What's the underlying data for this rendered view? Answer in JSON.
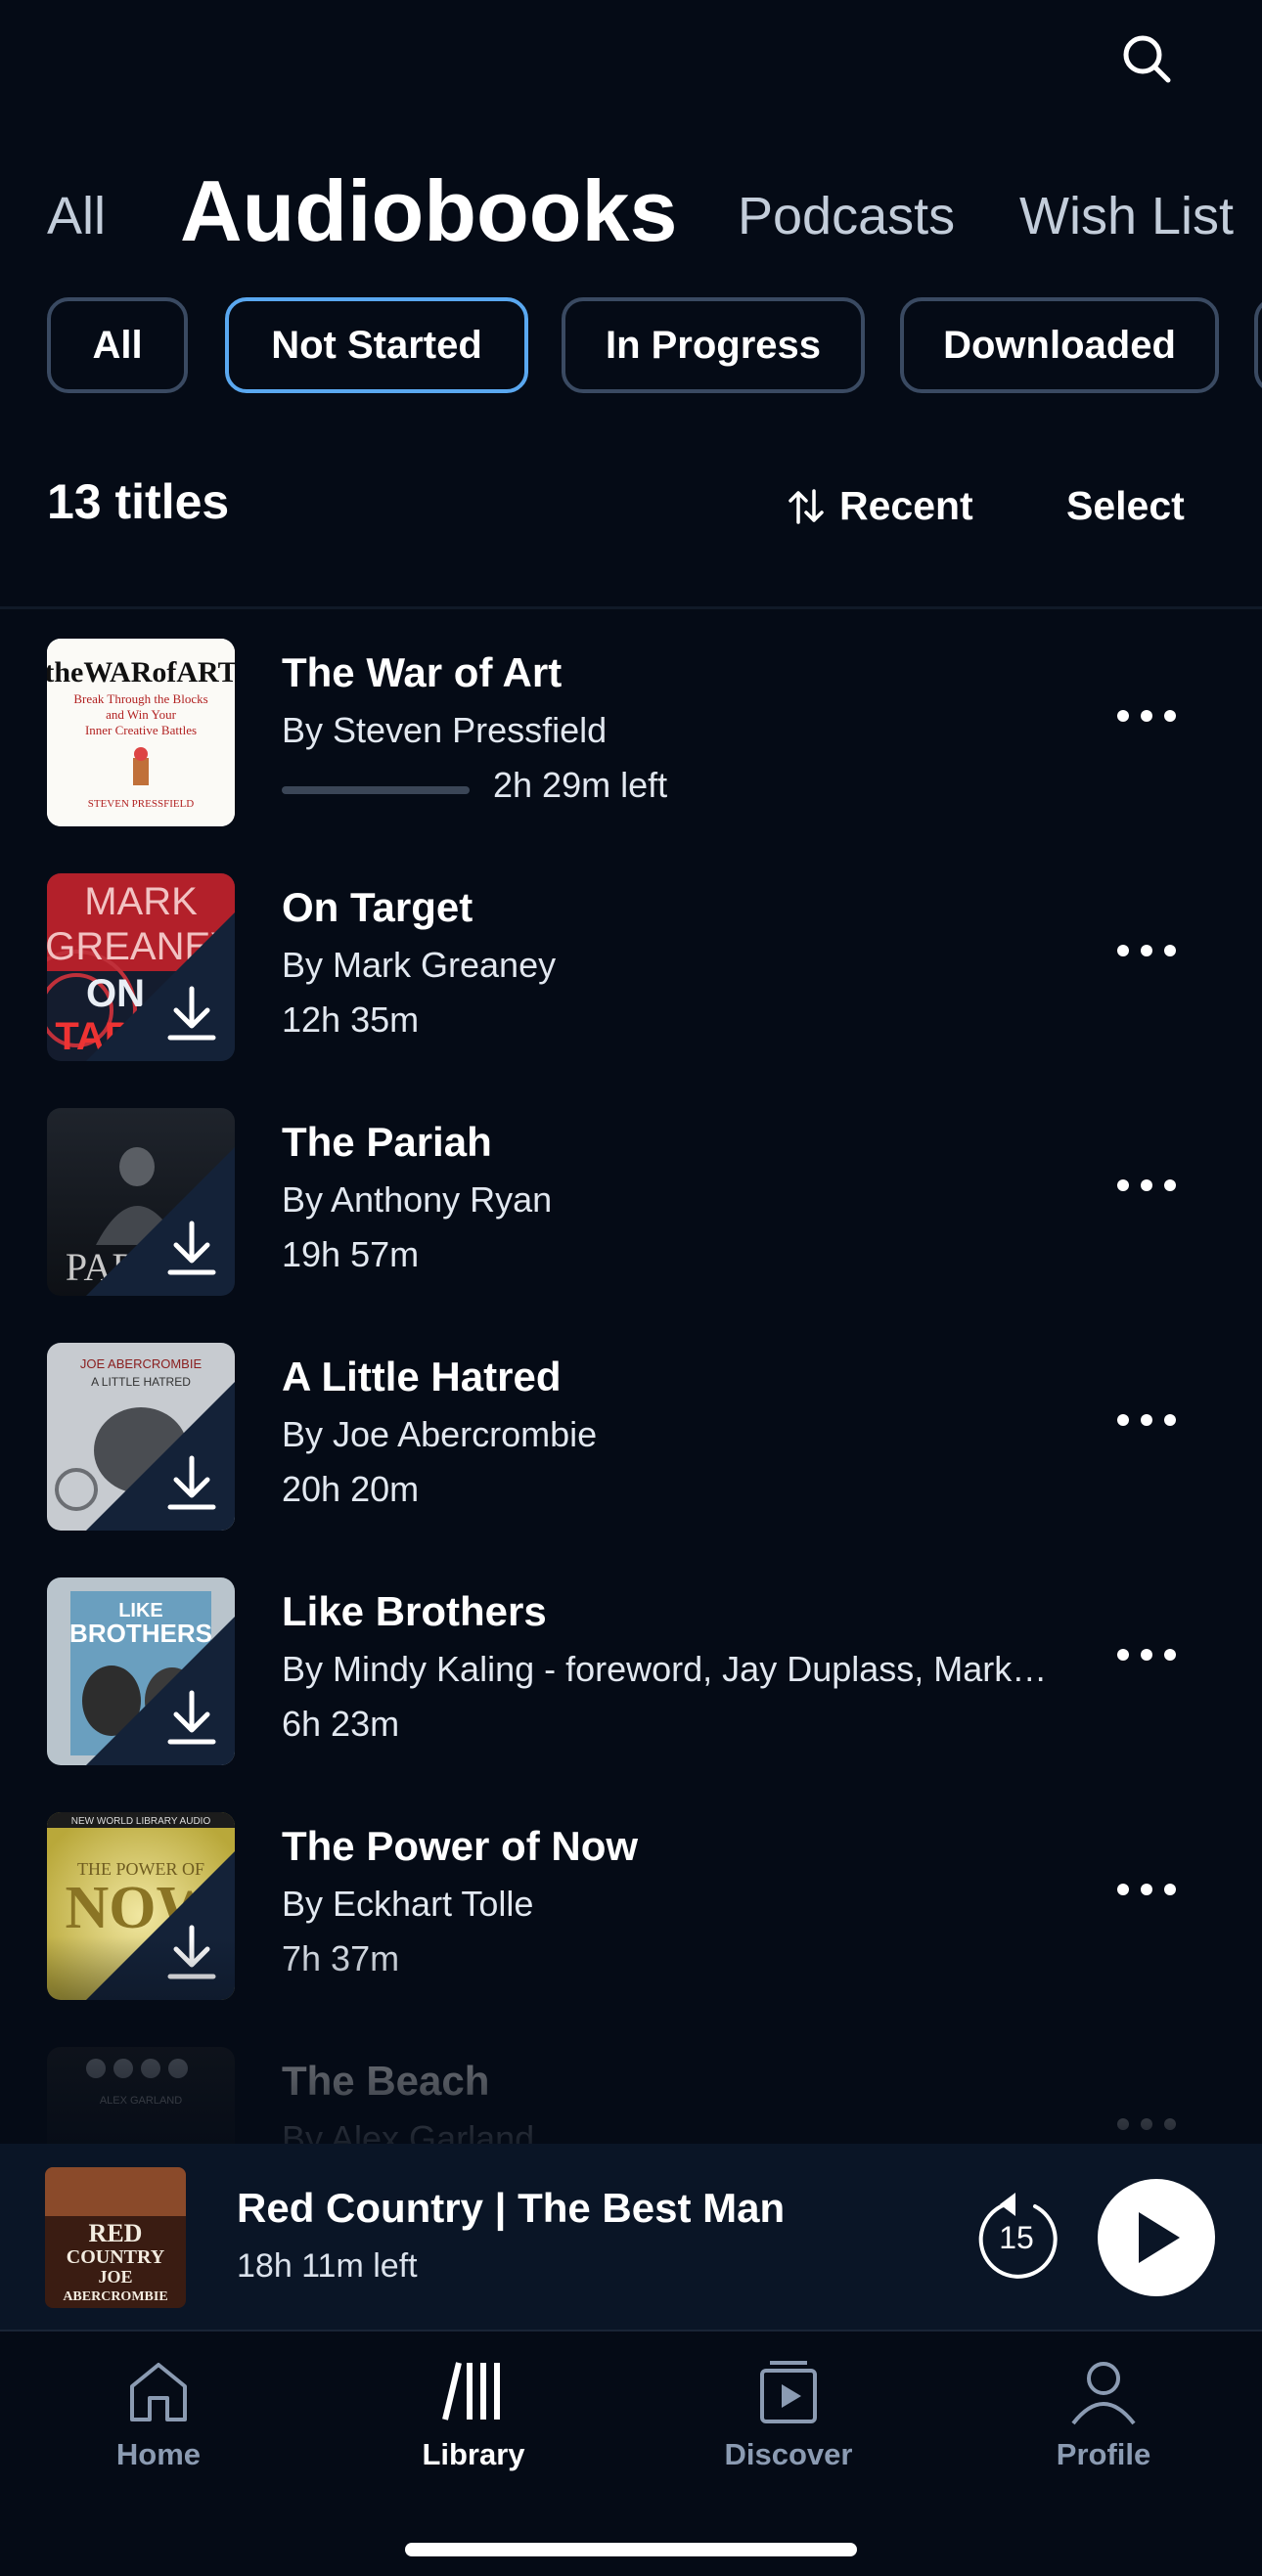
{
  "header": {
    "search_icon": "search-icon",
    "tabs": [
      {
        "label": "All",
        "active": false
      },
      {
        "label": "Audiobooks",
        "active": true
      },
      {
        "label": "Podcasts",
        "active": false
      },
      {
        "label": "Wish List",
        "active": false
      }
    ]
  },
  "filters": [
    {
      "label": "All",
      "active": false
    },
    {
      "label": "Not Started",
      "active": true
    },
    {
      "label": "In Progress",
      "active": false
    },
    {
      "label": "Downloaded",
      "active": false
    }
  ],
  "toolbar": {
    "count": "13 titles",
    "sort_label": "Recent",
    "select_label": "Select"
  },
  "books": [
    {
      "title": "The War of Art",
      "author": "By Steven Pressfield",
      "meta": "2h 29m left",
      "progress": 0.0,
      "downloaded": false,
      "cover_text": [
        "theWARofART",
        "Break Through the Blocks",
        "and Win Your",
        "Inner Creative Battles",
        "STEVEN PRESSFIELD"
      ]
    },
    {
      "title": "On Target",
      "author": "By Mark Greaney",
      "meta": "12h 35m",
      "downloaded": true,
      "cover_text": [
        "MARK",
        "GREANEY",
        "ON",
        "TAR"
      ]
    },
    {
      "title": "The Pariah",
      "author": "By Anthony Ryan",
      "meta": "19h 57m",
      "downloaded": true,
      "cover_text": [
        "PAR"
      ]
    },
    {
      "title": "A Little Hatred",
      "author": "By Joe Abercrombie",
      "meta": "20h 20m",
      "downloaded": true,
      "cover_text": [
        "JOE ABERCROMBIE",
        "A LITTLE HATRED"
      ]
    },
    {
      "title": "Like Brothers",
      "author": "By Mindy Kaling - foreword, Jay Duplass, Mark D...",
      "meta": "6h 23m",
      "downloaded": true,
      "cover_text": [
        "LIKE",
        "BROTHERS"
      ]
    },
    {
      "title": "The Power of Now",
      "author": "By Eckhart Tolle",
      "meta": "7h 37m",
      "downloaded": true,
      "cover_text": [
        "NEW WORLD LIBRARY AUDIO",
        "THE POWER OF",
        "NOW"
      ]
    },
    {
      "title": "The Beach",
      "author": "By Alex Garland",
      "meta": "",
      "downloaded": true,
      "cover_text": [
        "ALEX GARLAND"
      ]
    }
  ],
  "now_playing": {
    "title": "Red Country | The Best Man",
    "subtitle": "18h 11m left",
    "skip_seconds": "15",
    "cover_text": [
      "RED",
      "COUNTRY",
      "JOE",
      "ABERCROMBIE"
    ]
  },
  "bottom_nav": [
    {
      "label": "Home",
      "icon": "home-icon",
      "active": false
    },
    {
      "label": "Library",
      "icon": "library-icon",
      "active": true
    },
    {
      "label": "Discover",
      "icon": "discover-icon",
      "active": false
    },
    {
      "label": "Profile",
      "icon": "profile-icon",
      "active": false
    }
  ],
  "colors": {
    "background": "#050b16",
    "chip_border": "#3a4a62",
    "chip_active_border": "#5aa8f0",
    "nav_inactive": "#8b9bb2"
  }
}
